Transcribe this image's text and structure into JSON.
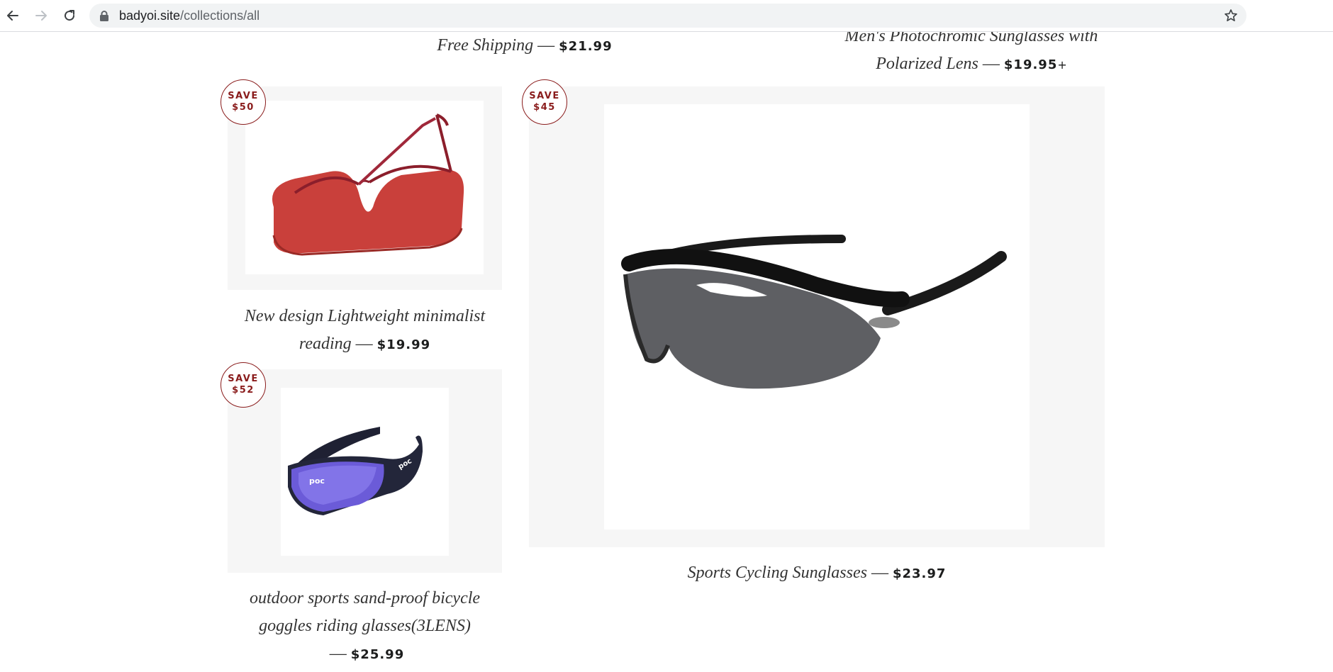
{
  "browser": {
    "url_host": "badyoi.site",
    "url_path": "/collections/all",
    "icons": [
      "back-arrow-icon",
      "forward-arrow-icon",
      "reload-icon",
      "lock-icon",
      "star-icon"
    ]
  },
  "colors": {
    "badge": "#8a1c1c",
    "card_background": "#f6f6f6",
    "text": "#333333"
  },
  "products": {
    "top_left": {
      "title": "Free Shipping",
      "separator": "—",
      "price": "$21.99"
    },
    "top_right": {
      "title_line1": "Men's Photochromic Sunglasses with",
      "title_line2": "Polarized Lens",
      "separator": "—",
      "price": "$19.95",
      "price_suffix": "+"
    },
    "reading": {
      "badge_save": "SAVE",
      "badge_amount": "$50",
      "title_line1": "New design Lightweight minimalist",
      "title_line2": "reading",
      "separator": "—",
      "price": "$19.99"
    },
    "cycling": {
      "badge_save": "SAVE",
      "badge_amount": "$45",
      "title": "Sports Cycling Sunglasses",
      "separator": "—",
      "price": "$23.97"
    },
    "goggles": {
      "badge_save": "SAVE",
      "badge_amount": "$52",
      "title_line1": "outdoor sports sand-proof bicycle",
      "title_line2": "goggles riding glasses(3LENS)",
      "separator": "—",
      "price": "$25.99"
    }
  }
}
